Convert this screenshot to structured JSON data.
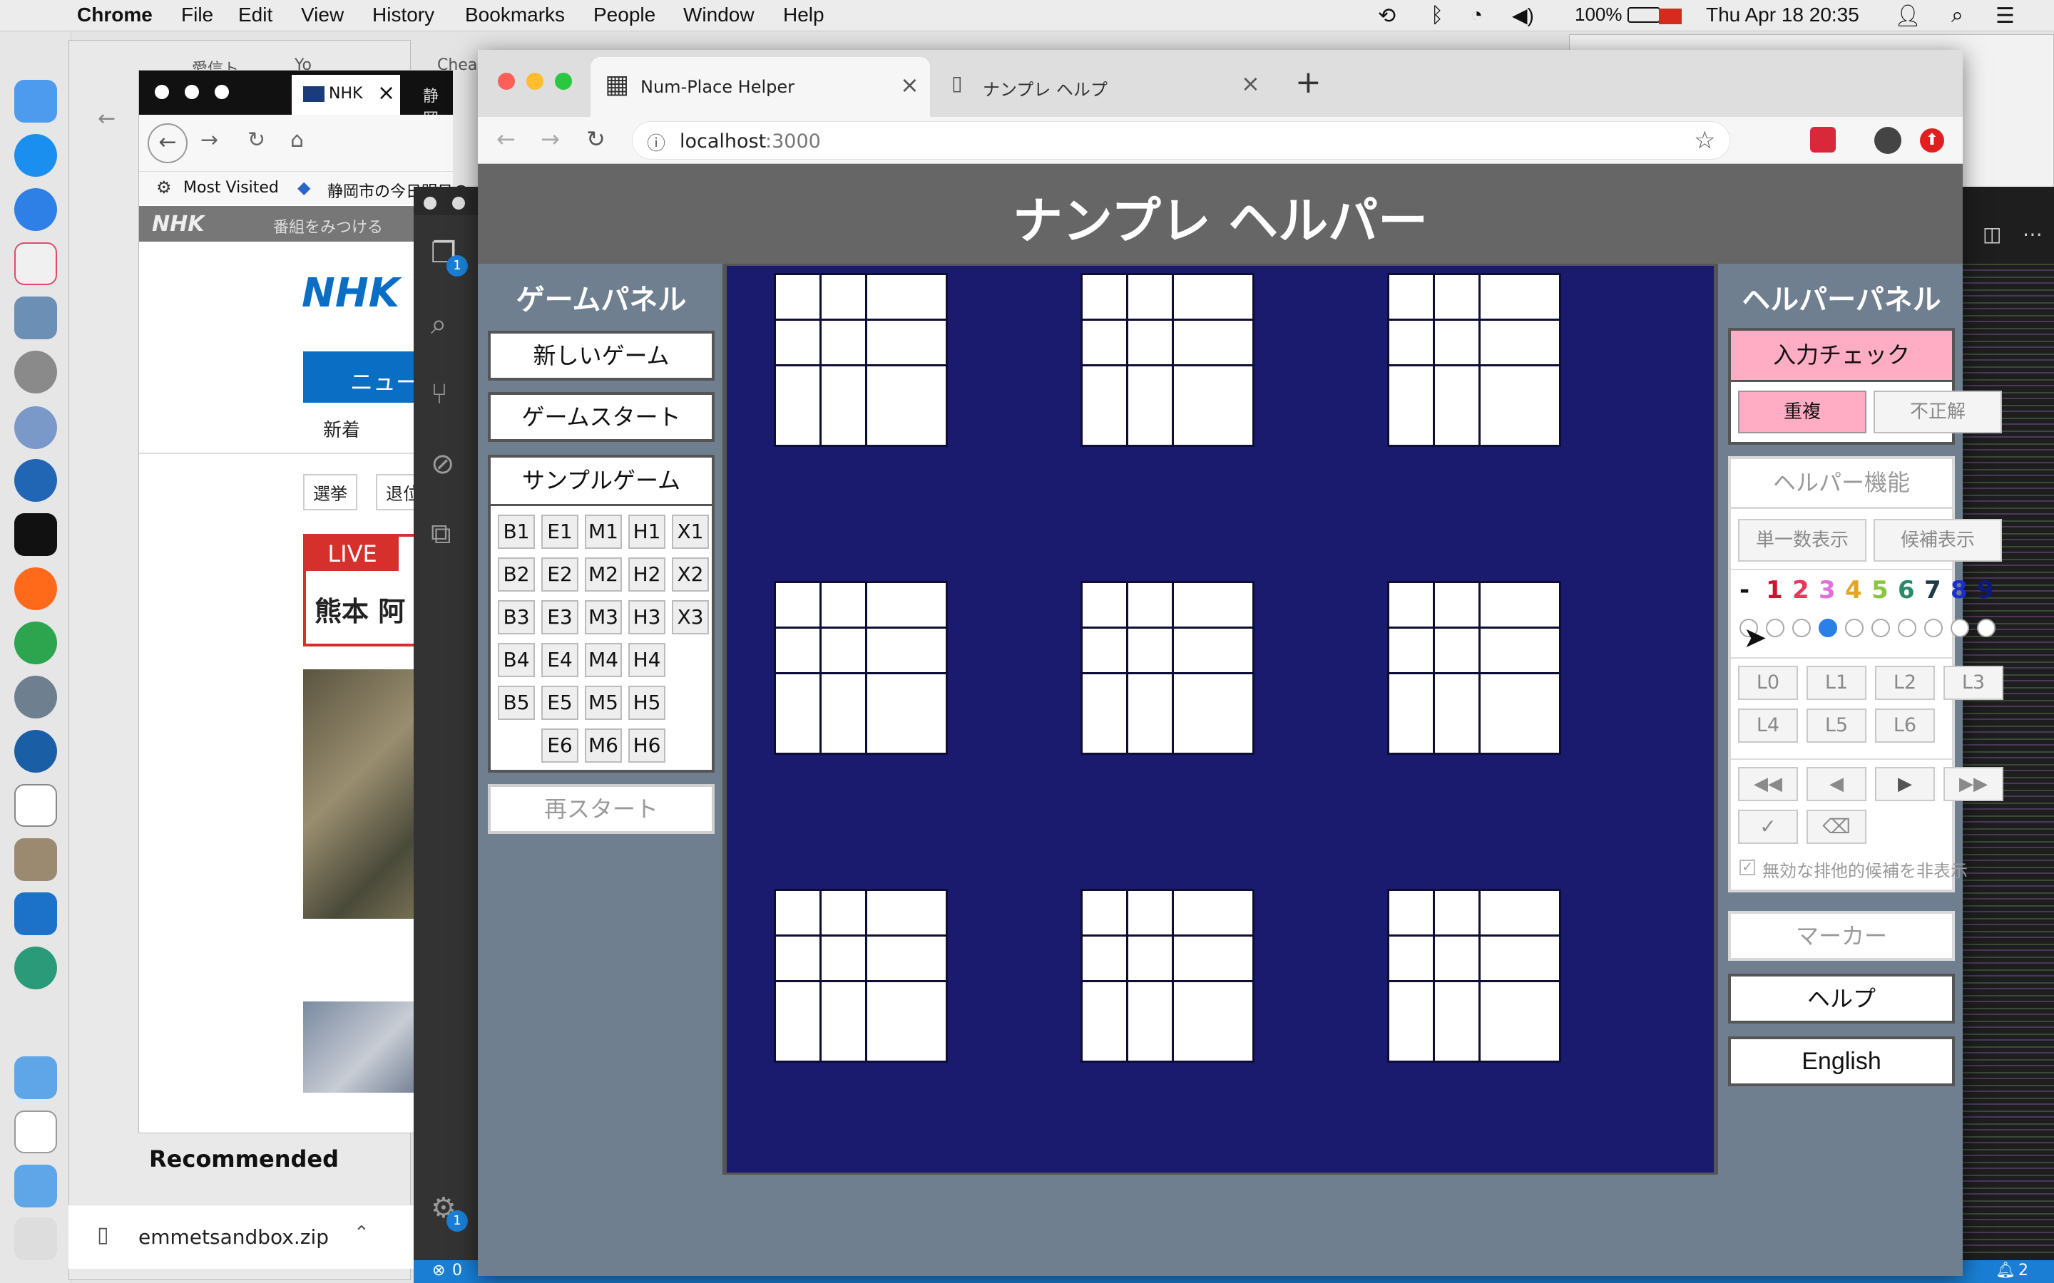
{
  "menubar": {
    "app": "Chrome",
    "items": [
      "File",
      "Edit",
      "View",
      "History",
      "Bookmarks",
      "People",
      "Window",
      "Help"
    ],
    "battery": "100%",
    "clock": "Thu Apr 18  20:35"
  },
  "bg_firefox": {
    "tab1": "愛信ト",
    "tab2": "Yo",
    "tab3": "Chea",
    "tab_nhk": "NHK",
    "tab_other": "静岡",
    "bookmark1": "Most Visited",
    "bookmark2": "静岡市の今日明日の",
    "nhk_nav": "番組をみつける",
    "nhk_logo": "NHK",
    "news_tab": "ニュー",
    "subtab": "新着",
    "chip1": "選挙",
    "chip2": "退位",
    "live": "LIVE",
    "headline": "熊本 阿",
    "recommended": "Recommended",
    "download": "emmetsandbox.zip"
  },
  "vscode": {
    "badge1": "1",
    "badge2": "1",
    "status_errors": "0",
    "status_bell": "2"
  },
  "browser": {
    "tab_active": "Num-Place Helper",
    "tab_other": "ナンプレ ヘルプ",
    "url_host": "localhost",
    "url_port": ":3000"
  },
  "app": {
    "title": "ナンプレ ヘルパー",
    "game_panel": {
      "title": "ゲームパネル",
      "new_game": "新しいゲーム",
      "start": "ゲームスタート",
      "sample": "サンプルゲーム",
      "restart": "再スタート",
      "samples": [
        [
          "B1",
          "E1",
          "M1",
          "H1",
          "X1"
        ],
        [
          "B2",
          "E2",
          "M2",
          "H2",
          "X2"
        ],
        [
          "B3",
          "E3",
          "M3",
          "H3",
          "X3"
        ],
        [
          "B4",
          "E4",
          "M4",
          "H4"
        ],
        [
          "B5",
          "E5",
          "M5",
          "H5"
        ],
        [
          "",
          "E6",
          "M6",
          "H6"
        ]
      ]
    },
    "helper_panel": {
      "title": "ヘルパーパネル",
      "input_check": "入力チェック",
      "dup": "重複",
      "incorrect": "不正解",
      "helper_func": "ヘルパー機能",
      "single": "単一数表示",
      "candidates": "候補表示",
      "digits": [
        "-",
        "1",
        "2",
        "3",
        "4",
        "5",
        "6",
        "7",
        "8",
        "9"
      ],
      "digit_colors": [
        "#111111",
        "#d0142c",
        "#e8375b",
        "#e36fd8",
        "#e3a524",
        "#8bc540",
        "#2a8a6a",
        "#1b3b4a",
        "#1a2ed0",
        "#0c1a80"
      ],
      "selected_digit": 3,
      "levels": [
        "L0",
        "L1",
        "L2",
        "L3",
        "L4",
        "L5",
        "L6"
      ],
      "hide_invalid": "無効な排他的候補を非表示",
      "marker": "マーカー",
      "help": "ヘルプ",
      "english": "English"
    }
  }
}
